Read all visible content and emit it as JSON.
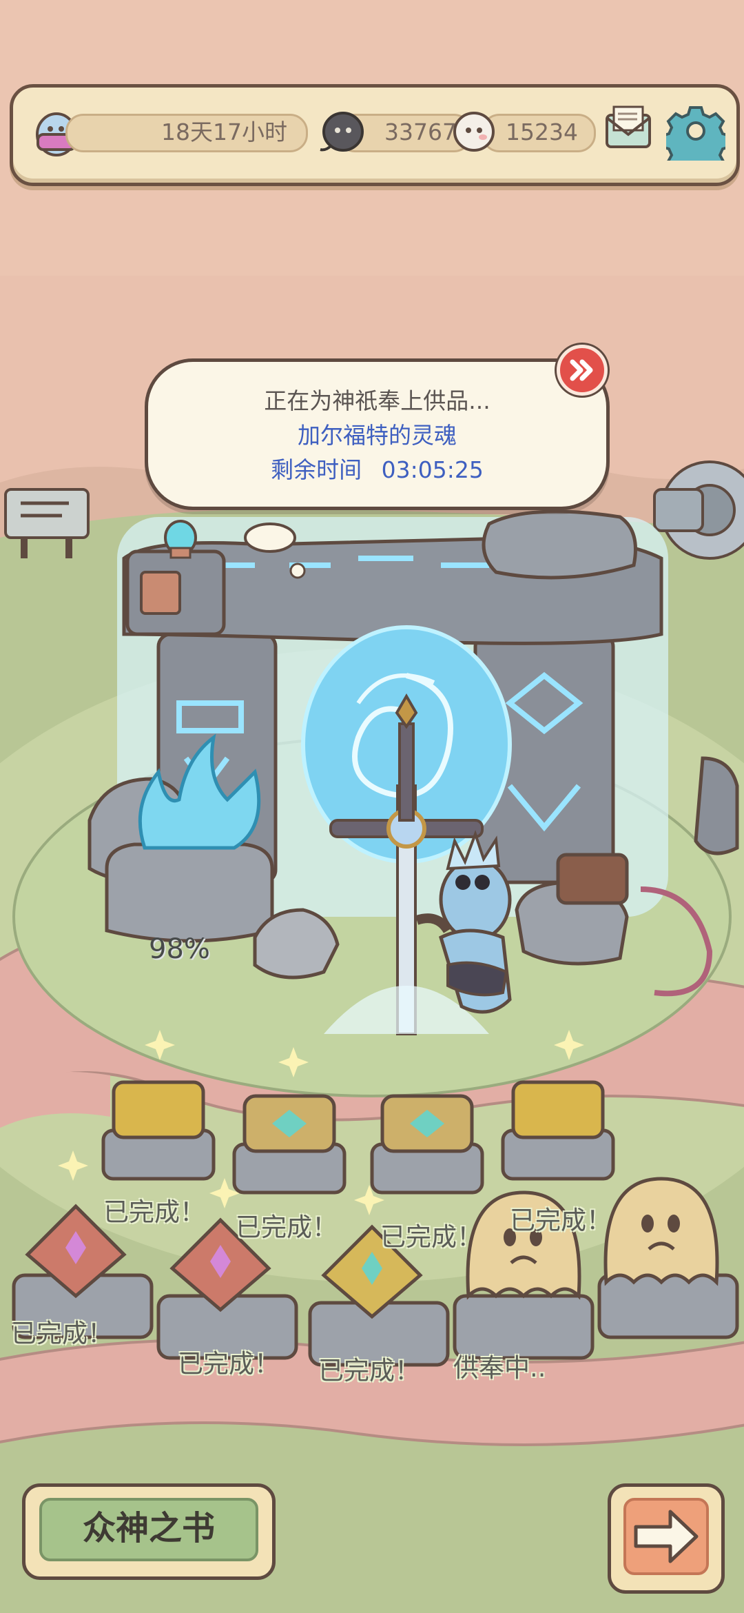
{
  "topbar": {
    "time_left": "18天17小时",
    "currency_dark": "33767",
    "currency_light": "15234",
    "icons": [
      "ghost-avatar-icon",
      "dark-soul-icon",
      "light-soul-icon",
      "mail-icon",
      "gear-icon"
    ]
  },
  "bubble": {
    "line1": "正在为神祇奉上供品...",
    "line2": "加尔福特的灵魂",
    "line3_label": "剩余时间",
    "line3_time": "03:05:25"
  },
  "altar": {
    "fire_percent": "98%"
  },
  "offerings": [
    {
      "label": "已完成！",
      "status": "done"
    },
    {
      "label": "已完成！",
      "status": "done"
    },
    {
      "label": "已完成！",
      "status": "done"
    },
    {
      "label": "已完成！",
      "status": "done"
    },
    {
      "label": "已完成！",
      "status": "done"
    },
    {
      "label": "已完成！",
      "status": "done"
    },
    {
      "label": "已完成！",
      "status": "done"
    },
    {
      "label": "供奉中..",
      "status": "in-progress"
    }
  ],
  "buttons": {
    "book_label": "众神之书",
    "next_icon": "arrow-right-icon"
  },
  "colors": {
    "accent_blue": "#3e5fc0",
    "bubble_text": "#5b5552",
    "panel_border": "#5e4a40"
  }
}
